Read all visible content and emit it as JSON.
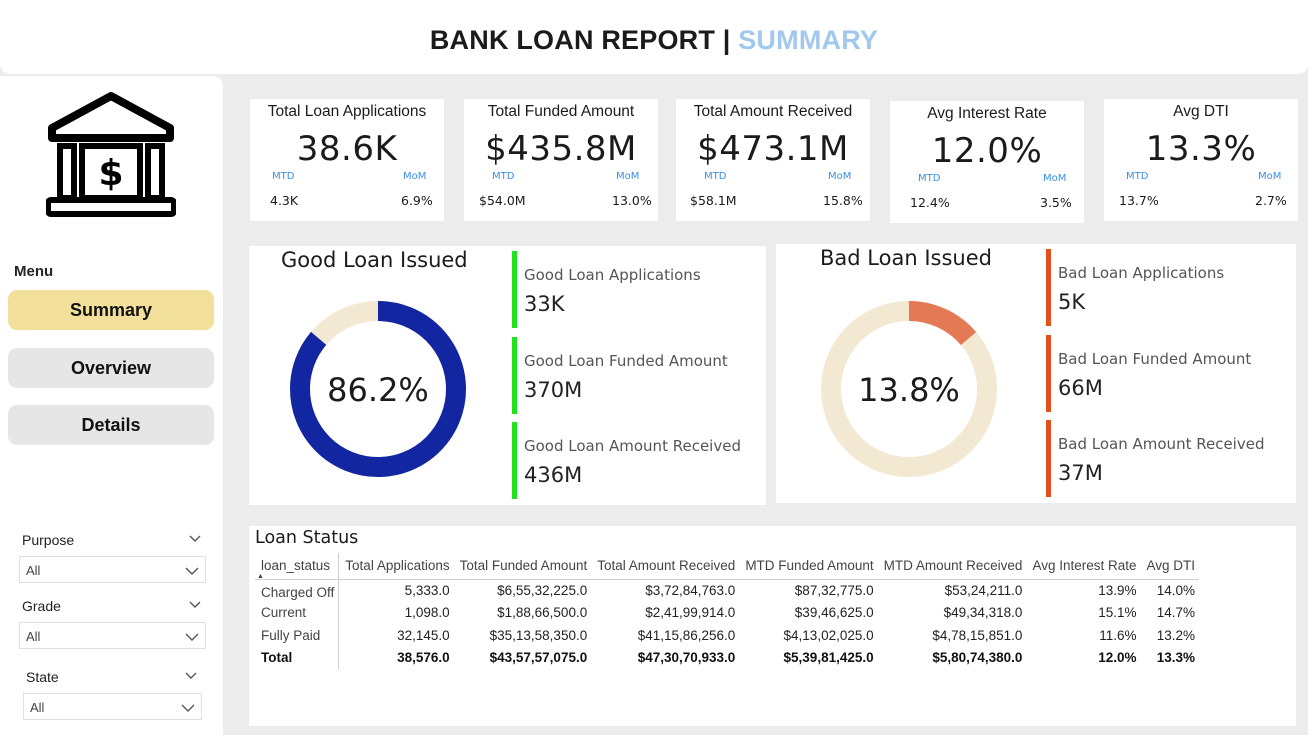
{
  "header": {
    "title_main": "BANK LOAN REPORT | ",
    "title_sub": "SUMMARY"
  },
  "sidebar": {
    "logo_icon": "bank-icon",
    "menu_label": "Menu",
    "nav": [
      {
        "label": "Summary",
        "active": true
      },
      {
        "label": "Overview",
        "active": false
      },
      {
        "label": "Details",
        "active": false
      }
    ],
    "slicers": [
      {
        "title": "Purpose",
        "value": "All"
      },
      {
        "title": "Grade",
        "value": "All"
      },
      {
        "title": "State",
        "value": "All"
      }
    ]
  },
  "kpis": [
    {
      "title": "Total Loan Applications",
      "value": "38.6K",
      "mtd_label": "MTD",
      "mom_label": "MoM",
      "mtd_value": "4.3K",
      "mom_value": "6.9%"
    },
    {
      "title": "Total Funded Amount",
      "value": "$435.8M",
      "mtd_label": "MTD",
      "mom_label": "MoM",
      "mtd_value": "$54.0M",
      "mom_value": "13.0%"
    },
    {
      "title": "Total Amount Received",
      "value": "$473.1M",
      "mtd_label": "MTD",
      "mom_label": "MoM",
      "mtd_value": "$58.1M",
      "mom_value": "15.8%"
    },
    {
      "title": "Avg Interest Rate",
      "value": "12.0%",
      "mtd_label": "MTD",
      "mom_label": "MoM",
      "mtd_value": "12.4%",
      "mom_value": "3.5%"
    },
    {
      "title": "Avg DTI",
      "value": "13.3%",
      "mtd_label": "MTD",
      "mom_label": "MoM",
      "mtd_value": "13.7%",
      "mom_value": "2.7%"
    }
  ],
  "good_loan": {
    "title": "Good Loan Issued",
    "percent_label": "86.2%",
    "percent": 86.2,
    "color": "#1226a2",
    "rest_color": "#f3e9d3",
    "bar_color": "#21e31c",
    "stats": [
      {
        "label": "Good Loan Applications",
        "value": "33K"
      },
      {
        "label": "Good Loan Funded Amount",
        "value": "370M"
      },
      {
        "label": "Good Loan Amount Received",
        "value": "436M"
      }
    ]
  },
  "bad_loan": {
    "title": "Bad Loan Issued",
    "percent_label": "13.8%",
    "percent": 13.8,
    "color": "#e47a55",
    "rest_color": "#f3e9d3",
    "bar_color": "#e2501d",
    "stats": [
      {
        "label": "Bad Loan Applications",
        "value": "5K"
      },
      {
        "label": "Bad Loan Funded Amount",
        "value": "66M"
      },
      {
        "label": "Bad Loan Amount Received",
        "value": "37M"
      }
    ]
  },
  "loan_status": {
    "title": "Loan Status",
    "columns": [
      "loan_status",
      "Total Applications",
      "Total Funded Amount",
      "Total Amount Received",
      "MTD Funded Amount",
      "MTD Amount Received",
      "Avg Interest Rate",
      "Avg DTI"
    ],
    "rows": [
      [
        "Charged Off",
        "5,333.0",
        "$6,55,32,225.0",
        "$3,72,84,763.0",
        "$87,32,775.0",
        "$53,24,211.0",
        "13.9%",
        "14.0%"
      ],
      [
        "Current",
        "1,098.0",
        "$1,88,66,500.0",
        "$2,41,99,914.0",
        "$39,46,625.0",
        "$49,34,318.0",
        "15.1%",
        "14.7%"
      ],
      [
        "Fully Paid",
        "32,145.0",
        "$35,13,58,350.0",
        "$41,15,86,256.0",
        "$4,13,02,025.0",
        "$4,78,15,851.0",
        "11.6%",
        "13.2%"
      ]
    ],
    "total": [
      "Total",
      "38,576.0",
      "$43,57,57,075.0",
      "$47,30,70,933.0",
      "$5,39,81,425.0",
      "$5,80,74,380.0",
      "12.0%",
      "13.3%"
    ]
  }
}
